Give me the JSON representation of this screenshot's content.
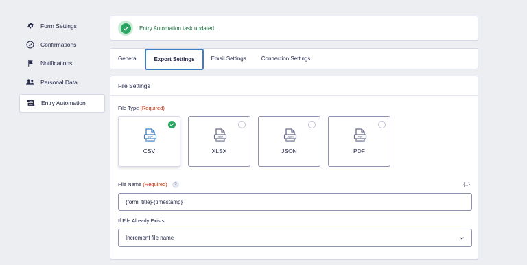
{
  "sidebar": {
    "items": [
      {
        "label": "Form Settings",
        "icon": "gear-icon"
      },
      {
        "label": "Confirmations",
        "icon": "check-circle-icon"
      },
      {
        "label": "Notifications",
        "icon": "flag-icon"
      },
      {
        "label": "Personal Data",
        "icon": "users-icon"
      },
      {
        "label": "Entry Automation",
        "icon": "automation-icon"
      }
    ],
    "active_index": 4
  },
  "notice": {
    "message": "Entry Automation task updated.",
    "icon": "check-icon",
    "color": "#2aa562"
  },
  "tabs": [
    {
      "label": "General"
    },
    {
      "label": "Export Settings"
    },
    {
      "label": "Email Settings"
    },
    {
      "label": "Connection Settings"
    }
  ],
  "active_tab_index": 1,
  "file_settings": {
    "title": "File Settings",
    "file_type": {
      "label": "File Type",
      "required_text": "(Required)",
      "options": [
        {
          "label": "CSV",
          "icon_text": "CSV",
          "selected": true
        },
        {
          "label": "XLSX",
          "icon_text": "XLSX",
          "selected": false
        },
        {
          "label": "JSON",
          "icon_text": "JSON",
          "selected": false
        },
        {
          "label": "PDF",
          "icon_text": "PDF",
          "selected": false
        }
      ]
    },
    "file_name": {
      "label": "File Name",
      "required_text": "(Required)",
      "help": "?",
      "merge_tag": "{..}",
      "value": "{form_title}-{timestamp}"
    },
    "if_exists": {
      "label": "If File Already Exists",
      "value": "Increment file name"
    }
  },
  "colors": {
    "accent": "#3e7ec2",
    "success": "#2aa562",
    "required": "#c02b0a",
    "selected_icon": "#3e7ec2",
    "unselected_icon": "#6b6d8a"
  }
}
